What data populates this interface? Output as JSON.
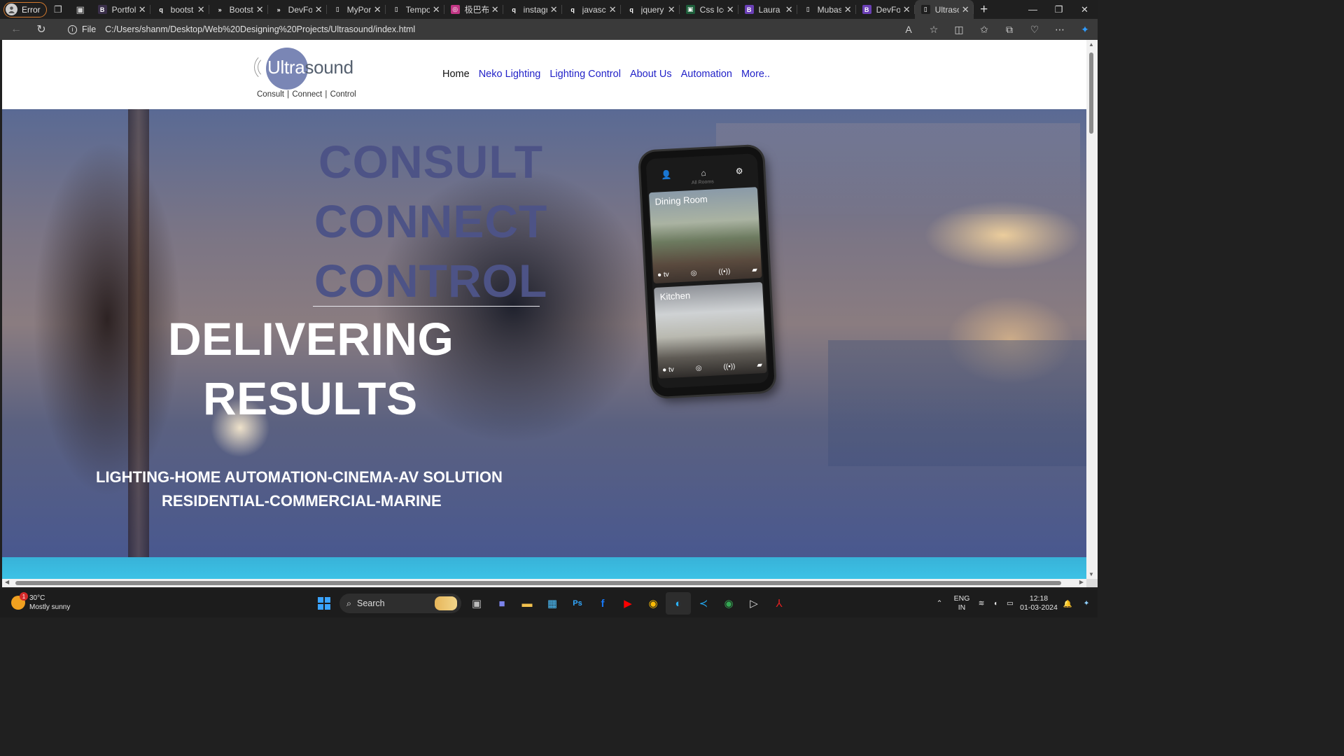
{
  "browser": {
    "profile_label": "Error",
    "tabs": [
      {
        "title": "Portfol",
        "fav": "B",
        "color": "#3a2f4a"
      },
      {
        "title": "bootst",
        "fav": "q",
        "color": "#1f1f1f"
      },
      {
        "title": "Bootst",
        "fav": "»",
        "color": "#1f1f1f"
      },
      {
        "title": "DevFol",
        "fav": "»",
        "color": "#1f1f1f"
      },
      {
        "title": "MyPort",
        "fav": "▯",
        "color": "#1f1f1f"
      },
      {
        "title": "Tempo",
        "fav": "▯",
        "color": "#1f1f1f"
      },
      {
        "title": "极巴布",
        "fav": "◎",
        "color": "#c13584"
      },
      {
        "title": "instagr",
        "fav": "q",
        "color": "#1f1f1f"
      },
      {
        "title": "javascr",
        "fav": "q",
        "color": "#1f1f1f"
      },
      {
        "title": "jquery",
        "fav": "q",
        "color": "#1f1f1f"
      },
      {
        "title": "Css Ico",
        "fav": "▣",
        "color": "#1d5e3a"
      },
      {
        "title": "Laura",
        "fav": "B",
        "color": "#6a3fb5"
      },
      {
        "title": "Mubas",
        "fav": "▯",
        "color": "#1f1f1f"
      },
      {
        "title": "DevFol",
        "fav": "B",
        "color": "#6a3fb5"
      },
      {
        "title": "Ultraso",
        "fav": "▯",
        "color": "#1f1f1f"
      }
    ],
    "file_label": "File",
    "url": "C:/Users/shanm/Desktop/Web%20Designing%20Projects/Ultrasound/index.html"
  },
  "site": {
    "logo": {
      "word_part1": "Ultra",
      "word_part2": "sound",
      "tagline": "Consult | Connect | Control"
    },
    "nav": [
      "Home",
      "Neko Lighting",
      "Lighting Control",
      "About Us",
      "Automation",
      "More.."
    ],
    "hero": {
      "word1": "CONSULT",
      "word2": "CONNECT",
      "word3": "CONTROL",
      "deliver1": "DELIVERING",
      "deliver2": "RESULTS",
      "services1": "LIGHTING-HOME AUTOMATION-CINEMA-AV SOLUTION",
      "services2": "RESIDENTIAL-COMMERCIAL-MARINE"
    },
    "phone": {
      "subtitle": "All Rooms",
      "room1": "Dining Room",
      "room2": "Kitchen",
      "appletv": "tv"
    }
  },
  "taskbar": {
    "temperature": "30°C",
    "weather": "Mostly sunny",
    "weather_badge": "1",
    "search_placeholder": "Search",
    "lang1": "ENG",
    "lang2": "IN",
    "time": "12:18",
    "date": "01-03-2024"
  }
}
